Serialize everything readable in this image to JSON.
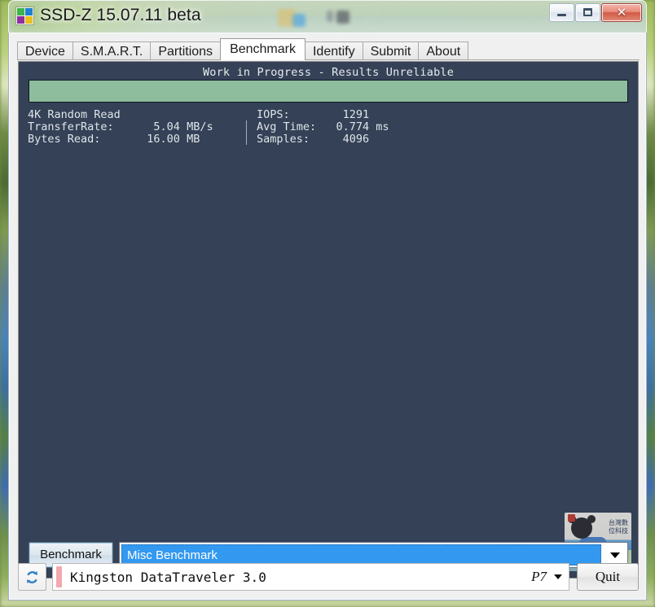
{
  "window": {
    "title": "SSD-Z 15.07.11 beta",
    "icon": "app-grid-icon",
    "buttons": {
      "minimize": "–",
      "maximize": "□",
      "close": "✕"
    }
  },
  "tabs": [
    {
      "label": "Device",
      "active": false
    },
    {
      "label": "S.M.A.R.T.",
      "active": false
    },
    {
      "label": "Partitions",
      "active": false
    },
    {
      "label": "Benchmark",
      "active": true
    },
    {
      "label": "Identify",
      "active": false
    },
    {
      "label": "Submit",
      "active": false
    },
    {
      "label": "About",
      "active": false
    }
  ],
  "benchmark": {
    "warning": "Work in Progress - Results Unreliable",
    "progress_percent": 100,
    "progress_color": "#8dbd9c",
    "panel_color": "#344156",
    "test_name": "4K Random Read",
    "left_column": "4K Random Read\nTransferRate:      5.04 MB/s\nBytes Read:       16.00 MB",
    "right_column": "IOPS:        1291\nAvg Time:   0.774 ms\nSamples:     4096",
    "metrics": {
      "transfer_rate_label": "TransferRate:",
      "transfer_rate_value": "5.04 MB/s",
      "bytes_read_label": "Bytes Read:",
      "bytes_read_value": "16.00 MB",
      "iops_label": "IOPS:",
      "iops_value": "1291",
      "avg_time_label": "Avg Time:",
      "avg_time_value": "0.774 ms",
      "samples_label": "Samples:",
      "samples_value": "4096"
    },
    "run_button": "Benchmark",
    "selected_benchmark": "Misc Benchmark",
    "dropdown_icon": "chevron-down-icon"
  },
  "watermark": {
    "text_line1": "台灣數",
    "text_line2": "位科技"
  },
  "statusbar": {
    "refresh_icon": "refresh-icon",
    "device": "Kingston DataTraveler 3.0",
    "port": "P7",
    "port_caret": "chevron-down-icon",
    "quit": "Quit"
  }
}
